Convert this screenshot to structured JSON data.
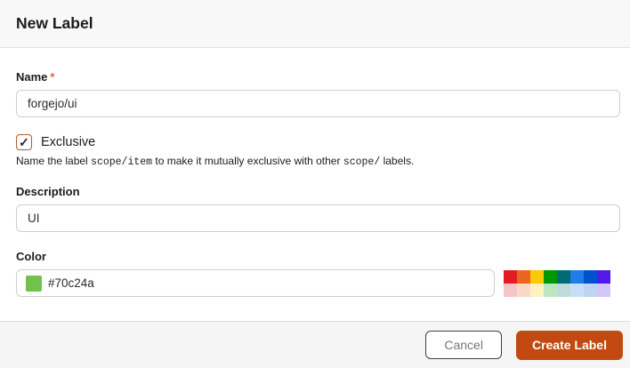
{
  "dialog": {
    "title": "New Label",
    "fields": {
      "name": {
        "label": "Name",
        "required_marker": "*",
        "value": "forgejo/ui"
      },
      "exclusive": {
        "label": "Exclusive",
        "checked": true,
        "check_glyph": "✓",
        "help": {
          "p1": "Name the label ",
          "code1": "scope/item",
          "p2": " to make it mutually exclusive with other ",
          "code2": "scope/",
          "p3": " labels."
        }
      },
      "description": {
        "label": "Description",
        "value": "UI"
      },
      "color": {
        "label": "Color",
        "value": "#70c24a",
        "swatch_color": "#70c24a"
      }
    },
    "palette": [
      "#e11d21",
      "#eb6420",
      "#fbca04",
      "#009800",
      "#006b75",
      "#207de5",
      "#0052cc",
      "#5319e7",
      "#f6c6c7",
      "#fad8c7",
      "#fef2c0",
      "#bfe5bf",
      "#bfdadc",
      "#c7def8",
      "#bfd4f2",
      "#d4c5f9"
    ],
    "actions": {
      "cancel": "Cancel",
      "submit": "Create Label"
    },
    "colors": {
      "accent": "#c24a12",
      "checkbox_border": "#b05c28",
      "required_red": "#e0624f",
      "header_bg": "#f8f8f8",
      "footer_bg": "#f5f5f5"
    }
  }
}
